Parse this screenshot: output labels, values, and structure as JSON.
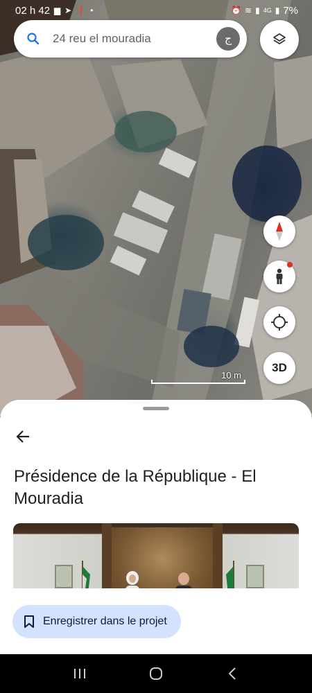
{
  "status_bar": {
    "time": "02 h 42",
    "network": "4G",
    "battery": "7%"
  },
  "search": {
    "query": "24 reu el mouradia",
    "avatar_letter": "ج"
  },
  "map": {
    "scale_label": "10 m",
    "three_d_label": "3D"
  },
  "place": {
    "title": "Présidence de la République - El Mouradia"
  },
  "actions": {
    "save_label": "Enregistrer dans le projet"
  },
  "colors": {
    "save_button_bg": "#d3e3fd",
    "search_icon": "#1a73e8",
    "compass_red": "#d93025"
  }
}
